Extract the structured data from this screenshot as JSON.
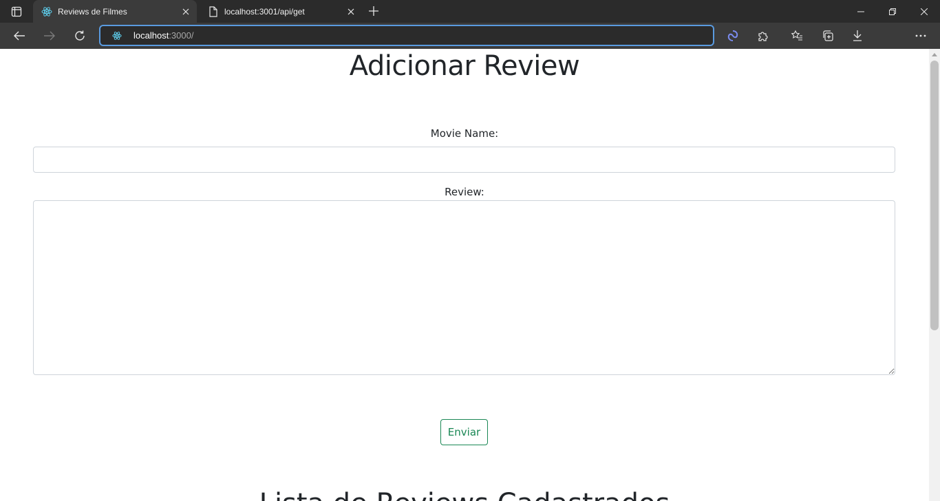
{
  "browser": {
    "tabs": [
      {
        "title": "Reviews de Filmes",
        "active": true,
        "icon": "react-icon"
      },
      {
        "title": "localhost:3001/api/get",
        "active": false,
        "icon": "page-icon"
      }
    ],
    "address": {
      "host": "localhost",
      "path": ":3000/"
    },
    "colors": {
      "tabbar": "#2b2b2b",
      "toolbar": "#3b3b3b",
      "address_border": "#5a9be0"
    }
  },
  "page": {
    "title": "Adicionar Review",
    "movie_label": "Movie Name:",
    "movie_value": "",
    "review_label": "Review:",
    "review_value": "",
    "submit_label": "Enviar",
    "list_title": "Lista de Reviews Cadastrados",
    "colors": {
      "button": "#198754",
      "text": "#212529",
      "input_border": "#ced4da"
    }
  }
}
